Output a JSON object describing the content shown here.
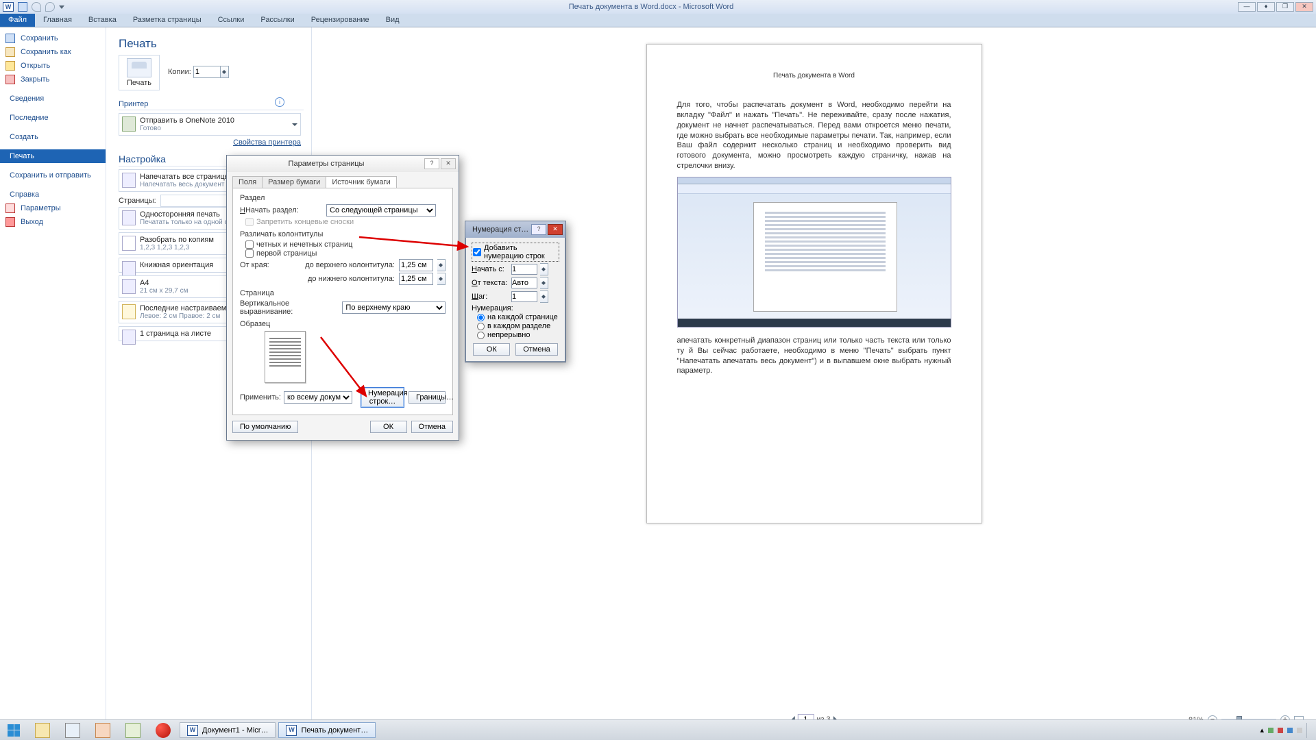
{
  "title": "Печать документа в Word.docx - Microsoft Word",
  "ribbon": {
    "file": "Файл",
    "home": "Главная",
    "insert": "Вставка",
    "layout": "Разметка страницы",
    "refs": "Ссылки",
    "mail": "Рассылки",
    "review": "Рецензирование",
    "view": "Вид"
  },
  "nav": {
    "save": "Сохранить",
    "saveas": "Сохранить как",
    "open": "Открыть",
    "close": "Закрыть",
    "info": "Сведения",
    "recent": "Последние",
    "new": "Создать",
    "print": "Печать",
    "share": "Сохранить и отправить",
    "help": "Справка",
    "options": "Параметры",
    "exit": "Выход"
  },
  "print": {
    "heading": "Печать",
    "button": "Печать",
    "copies_label": "Копии:",
    "copies_value": "1",
    "printer_heading": "Принтер",
    "printer_name": "Отправить в OneNote 2010",
    "printer_status": "Готово",
    "printer_props": "Свойства принтера",
    "settings_heading": "Настройка",
    "opt_allpages_main": "Напечатать все страницы",
    "opt_allpages_sub": "Напечатать весь документ",
    "pages_label": "Страницы:",
    "opt_oneside_main": "Односторонняя печать",
    "opt_oneside_sub": "Печатать только на одной сторо",
    "opt_collate_main": "Разобрать по копиям",
    "opt_collate_sub": "1,2,3   1,2,3   1,2,3",
    "opt_orient": "Книжная ориентация",
    "opt_size_main": "A4",
    "opt_size_sub": "21 см x 29,7 см",
    "opt_margins_main": "Последние настраиваемые по…",
    "opt_margins_sub": "Левое: 2 см   Правое: 2 см",
    "opt_perpage": "1 страница на листе"
  },
  "preview": {
    "doc_title": "Печать документа в Word",
    "para1": "Для того, чтобы распечатать документ в Word, необходимо перейти на вкладку \"Файл\" и нажать \"Печать\". Не переживайте, сразу после нажатия, документ не начнет распечатываться. Перед вами откроется меню печати, где можно выбрать все необходимые параметры печати. Так, например, если Ваш файл содержит несколько страниц и необходимо проверить вид готового документа, можно просмотреть каждую страничку, нажав на стрелочки внизу.",
    "para2": "апечатать конкретный диапазон страниц или только часть текста или только ту й Вы сейчас работаете, необходимо в меню \"Печать\" выбрать пункт \"Напечатать апечатать весь документ\") и в выпавшем окне выбрать нужный параметр.",
    "page_field": "1",
    "page_of": "из 3",
    "zoom": "81%"
  },
  "dlg_page": {
    "title": "Параметры страницы",
    "tab_margins": "Поля",
    "tab_paper": "Размер бумаги",
    "tab_source": "Источник бумаги",
    "grp_section": "Раздел",
    "lbl_start": "Начать раздел:",
    "val_start": "Со следующей страницы",
    "chk_suppress": "Запретить концевые сноски",
    "grp_headers": "Различать колонтитулы",
    "chk_oddeven": "четных и нечетных страниц",
    "chk_first": "первой страницы",
    "lbl_edge": "От края:",
    "lbl_header": "до верхнего колонтитула:",
    "lbl_footer": "до нижнего колонтитула:",
    "val_header": "1,25 см",
    "val_footer": "1,25 см",
    "grp_page": "Страница",
    "lbl_valign": "Вертикальное выравнивание:",
    "val_valign": "По верхнему краю",
    "grp_sample": "Образец",
    "lbl_apply": "Применить:",
    "val_apply": "ко всему документу",
    "btn_lines": "Нумерация строк…",
    "btn_borders": "Границы…",
    "btn_default": "По умолчанию",
    "btn_ok": "ОК",
    "btn_cancel": "Отмена"
  },
  "dlg_line": {
    "title": "Нумерация ст…",
    "chk_add": "Добавить нумерацию строк",
    "lbl_start": "Начать с:",
    "val_start": "1",
    "lbl_from": "От текста:",
    "val_from": "Авто",
    "lbl_step": "Шаг:",
    "val_step": "1",
    "lbl_mode": "Нумерация:",
    "rad_each": "на каждой странице",
    "rad_section": "в каждом разделе",
    "rad_cont": "непрерывно",
    "btn_ok": "ОК",
    "btn_cancel": "Отмена"
  },
  "taskbar": {
    "doc1": "Документ1 - Micr…",
    "doc2": "Печать документ…"
  }
}
